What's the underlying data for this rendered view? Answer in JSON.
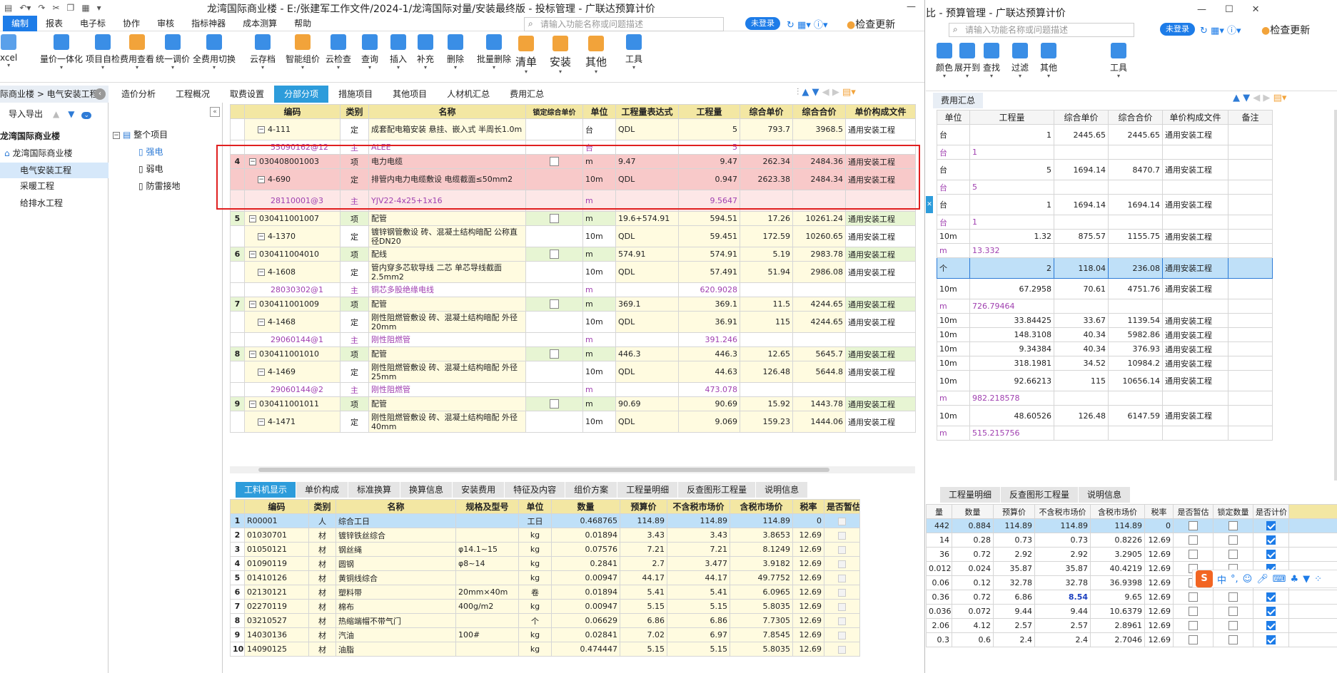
{
  "left": {
    "title": "龙湾国际商业楼 - E:/张建军工作文件/2024-1/龙湾国际对量/安装最终版 - 投标管理 - 广联达预算计价",
    "menu": [
      "编制",
      "报表",
      "电子标",
      "协作",
      "审核",
      "指标神器",
      "成本测算",
      "帮助"
    ],
    "search_placeholder": "请输入功能名称或问题描述",
    "login": "未登录",
    "check_update": "检查更新",
    "ribbon": [
      "xcel",
      "量价一体化",
      "项目自检",
      "费用查看",
      "统一调价",
      "全费用切换",
      "云存档",
      "智能组价",
      "云检查",
      "查询",
      "插入",
      "补充",
      "删除",
      "批量删除",
      "清单",
      "安装",
      "其他",
      "工具"
    ],
    "breadcrumb": "际商业楼 > 电气安装工程",
    "tabs": [
      "造价分析",
      "工程概况",
      "取费设置",
      "分部分项",
      "措施项目",
      "其他项目",
      "人材机汇总",
      "费用汇总"
    ],
    "import_export": "导入导出",
    "project_tree": [
      "龙湾国际商业楼",
      "龙湾国际商业楼",
      "电气安装工程",
      "采暖工程",
      "给排水工程"
    ],
    "sub_tree": [
      "整个项目",
      "强电",
      "弱电",
      "防雷接地"
    ],
    "main_headers": [
      "编码",
      "类别",
      "名称",
      "锁定综合单价",
      "单位",
      "工程量表达式",
      "工程量",
      "综合单价",
      "综合合价",
      "单价构成文件"
    ],
    "main_rows": [
      {
        "no": "",
        "code": "4-111",
        "type": "定",
        "name": "成套配电箱安装 悬挂、嵌入式 半周长1.0m",
        "lock": "",
        "unit": "台",
        "expr": "QDL",
        "qty": "5",
        "price": "793.7",
        "total": "3968.5",
        "file": "通用安装工程",
        "cls": "rd"
      },
      {
        "no": "",
        "code": "55090162@12",
        "type": "主",
        "name": "ALEE",
        "lock": "",
        "unit": "台",
        "expr": "",
        "qty": "5",
        "price": "",
        "total": "",
        "file": "",
        "cls": "rm"
      },
      {
        "no": "4",
        "code": "030408001003",
        "type": "项",
        "name": "电力电缆",
        "lock": "cb",
        "unit": "m",
        "expr": "9.47",
        "qty": "9.47",
        "price": "262.34",
        "total": "2484.36",
        "file": "通用安装工程",
        "cls": "rp"
      },
      {
        "no": "",
        "code": "4-690",
        "type": "定",
        "name": "排管内电力电缆敷设 电缆截面≤50mm2",
        "lock": "",
        "unit": "10m",
        "expr": "QDL",
        "qty": "0.947",
        "price": "2623.38",
        "total": "2484.34",
        "file": "通用安装工程",
        "cls": "rp"
      },
      {
        "no": "",
        "code": "28110001@3",
        "type": "主",
        "name": "YJV22-4x25+1x16",
        "lock": "",
        "unit": "m",
        "expr": "",
        "qty": "9.5647",
        "price": "",
        "total": "",
        "file": "",
        "cls": "rpm"
      },
      {
        "no": "5",
        "code": "030411001007",
        "type": "项",
        "name": "配管",
        "lock": "cb",
        "unit": "m",
        "expr": "19.6+574.91",
        "qty": "594.51",
        "price": "17.26",
        "total": "10261.24",
        "file": "通用安装工程",
        "cls": "rq"
      },
      {
        "no": "",
        "code": "4-1370",
        "type": "定",
        "name": "镀锌钢管敷设 砖、混凝土结构暗配 公称直径DN20",
        "lock": "",
        "unit": "10m",
        "expr": "QDL",
        "qty": "59.451",
        "price": "172.59",
        "total": "10260.65",
        "file": "通用安装工程",
        "cls": "rd"
      },
      {
        "no": "6",
        "code": "030411004010",
        "type": "项",
        "name": "配线",
        "lock": "cb",
        "unit": "m",
        "expr": "574.91",
        "qty": "574.91",
        "price": "5.19",
        "total": "2983.78",
        "file": "通用安装工程",
        "cls": "rq"
      },
      {
        "no": "",
        "code": "4-1608",
        "type": "定",
        "name": "管内穿多芯软导线 二芯 单芯导线截面2.5mm2",
        "lock": "",
        "unit": "10m",
        "expr": "QDL",
        "qty": "57.491",
        "price": "51.94",
        "total": "2986.08",
        "file": "通用安装工程",
        "cls": "rd"
      },
      {
        "no": "",
        "code": "28030302@1",
        "type": "主",
        "name": "铜芯多股绝缘电线",
        "lock": "",
        "unit": "m",
        "expr": "",
        "qty": "620.9028",
        "price": "",
        "total": "",
        "file": "",
        "cls": "rm"
      },
      {
        "no": "7",
        "code": "030411001009",
        "type": "项",
        "name": "配管",
        "lock": "cb",
        "unit": "m",
        "expr": "369.1",
        "qty": "369.1",
        "price": "11.5",
        "total": "4244.65",
        "file": "通用安装工程",
        "cls": "rq"
      },
      {
        "no": "",
        "code": "4-1468",
        "type": "定",
        "name": "刚性阻燃管敷设 砖、混凝土结构暗配 外径20mm",
        "lock": "",
        "unit": "10m",
        "expr": "QDL",
        "qty": "36.91",
        "price": "115",
        "total": "4244.65",
        "file": "通用安装工程",
        "cls": "rd"
      },
      {
        "no": "",
        "code": "29060144@1",
        "type": "主",
        "name": "刚性阻燃管",
        "lock": "",
        "unit": "m",
        "expr": "",
        "qty": "391.246",
        "price": "",
        "total": "",
        "file": "",
        "cls": "rm"
      },
      {
        "no": "8",
        "code": "030411001010",
        "type": "项",
        "name": "配管",
        "lock": "cb",
        "unit": "m",
        "expr": "446.3",
        "qty": "446.3",
        "price": "12.65",
        "total": "5645.7",
        "file": "通用安装工程",
        "cls": "rq"
      },
      {
        "no": "",
        "code": "4-1469",
        "type": "定",
        "name": "刚性阻燃管敷设 砖、混凝土结构暗配 外径25mm",
        "lock": "",
        "unit": "10m",
        "expr": "QDL",
        "qty": "44.63",
        "price": "126.48",
        "total": "5644.8",
        "file": "通用安装工程",
        "cls": "rd"
      },
      {
        "no": "",
        "code": "29060144@2",
        "type": "主",
        "name": "刚性阻燃管",
        "lock": "",
        "unit": "m",
        "expr": "",
        "qty": "473.078",
        "price": "",
        "total": "",
        "file": "",
        "cls": "rm"
      },
      {
        "no": "9",
        "code": "030411001011",
        "type": "项",
        "name": "配管",
        "lock": "cb",
        "unit": "m",
        "expr": "90.69",
        "qty": "90.69",
        "price": "15.92",
        "total": "1443.78",
        "file": "通用安装工程",
        "cls": "rq"
      },
      {
        "no": "",
        "code": "4-1471",
        "type": "定",
        "name": "刚性阻燃管敷设 砖、混凝土结构暗配 外径40mm",
        "lock": "",
        "unit": "10m",
        "expr": "QDL",
        "qty": "9.069",
        "price": "159.23",
        "total": "1444.06",
        "file": "通用安装工程",
        "cls": "rd"
      }
    ],
    "bottom_tabs": [
      "工料机显示",
      "单价构成",
      "标准换算",
      "换算信息",
      "安装费用",
      "特征及内容",
      "组价方案",
      "工程量明细",
      "反查图形工程量",
      "说明信息"
    ],
    "bottom_headers": [
      "编码",
      "类别",
      "名称",
      "规格及型号",
      "单位",
      "数量",
      "预算价",
      "不含税市场价",
      "含税市场价",
      "税率",
      "是否暂估"
    ],
    "bottom_rows": [
      {
        "no": "1",
        "code": "R00001",
        "type": "人",
        "name": "综合工日",
        "spec": "",
        "unit": "工日",
        "qty": "0.468765",
        "budget": "114.89",
        "mkt": "114.89",
        "mkt_tax": "114.89",
        "rate": "0"
      },
      {
        "no": "2",
        "code": "01030701",
        "type": "材",
        "name": "镀锌铁丝综合",
        "spec": "",
        "unit": "kg",
        "qty": "0.01894",
        "budget": "3.43",
        "mkt": "3.43",
        "mkt_tax": "3.8653",
        "rate": "12.69"
      },
      {
        "no": "3",
        "code": "01050121",
        "type": "材",
        "name": "钢丝绳",
        "spec": "φ14.1~15",
        "unit": "kg",
        "qty": "0.07576",
        "budget": "7.21",
        "mkt": "7.21",
        "mkt_tax": "8.1249",
        "rate": "12.69"
      },
      {
        "no": "4",
        "code": "01090119",
        "type": "材",
        "name": "圆钢",
        "spec": "φ8~14",
        "unit": "kg",
        "qty": "0.2841",
        "budget": "2.7",
        "mkt": "3.477",
        "mkt_tax": "3.9182",
        "rate": "12.69"
      },
      {
        "no": "5",
        "code": "01410126",
        "type": "材",
        "name": "黄铜线综合",
        "spec": "",
        "unit": "kg",
        "qty": "0.00947",
        "budget": "44.17",
        "mkt": "44.17",
        "mkt_tax": "49.7752",
        "rate": "12.69"
      },
      {
        "no": "6",
        "code": "02130121",
        "type": "材",
        "name": "塑料带",
        "spec": "20mm×40m",
        "unit": "卷",
        "qty": "0.01894",
        "budget": "5.41",
        "mkt": "5.41",
        "mkt_tax": "6.0965",
        "rate": "12.69"
      },
      {
        "no": "7",
        "code": "02270119",
        "type": "材",
        "name": "棉布",
        "spec": "400g/m2",
        "unit": "kg",
        "qty": "0.00947",
        "budget": "5.15",
        "mkt": "5.15",
        "mkt_tax": "5.8035",
        "rate": "12.69"
      },
      {
        "no": "8",
        "code": "03210527",
        "type": "材",
        "name": "热缩端帽不带气门",
        "spec": "",
        "unit": "个",
        "qty": "0.06629",
        "budget": "6.86",
        "mkt": "6.86",
        "mkt_tax": "7.7305",
        "rate": "12.69"
      },
      {
        "no": "9",
        "code": "14030136",
        "type": "材",
        "name": "汽油",
        "spec": "100#",
        "unit": "kg",
        "qty": "0.02841",
        "budget": "7.02",
        "mkt": "6.97",
        "mkt_tax": "7.8545",
        "rate": "12.69"
      },
      {
        "no": "10",
        "code": "14090125",
        "type": "材",
        "name": "油脂",
        "spec": "",
        "unit": "kg",
        "qty": "0.474447",
        "budget": "5.15",
        "mkt": "5.15",
        "mkt_tax": "5.8035",
        "rate": "12.69"
      }
    ]
  },
  "right": {
    "title": "比 - 预算管理 - 广联达预算计价",
    "search_placeholder": "请输入功能名称或问题描述",
    "login": "未登录",
    "check_update": "检查更新",
    "ribbon": [
      "颜色",
      "展开到",
      "查找",
      "过滤",
      "其他",
      "工具"
    ],
    "tab": "费用汇总",
    "headers": [
      "单位",
      "工程量",
      "综合单价",
      "综合合价",
      "单价构成文件",
      "备注"
    ],
    "rows": [
      {
        "unit": "台",
        "qty": "1",
        "price": "2445.65",
        "total": "2445.65",
        "file": "通用安装工程",
        "m": false,
        "tall": true
      },
      {
        "unit": "台",
        "qty": "1",
        "price": "",
        "total": "",
        "file": "",
        "m": true,
        "tall": false
      },
      {
        "unit": "台",
        "qty": "5",
        "price": "1694.14",
        "total": "8470.7",
        "file": "通用安装工程",
        "m": false,
        "tall": true
      },
      {
        "unit": "台",
        "qty": "5",
        "price": "",
        "total": "",
        "file": "",
        "m": true,
        "tall": false
      },
      {
        "unit": "台",
        "qty": "1",
        "price": "1694.14",
        "total": "1694.14",
        "file": "通用安装工程",
        "m": false,
        "tall": true
      },
      {
        "unit": "台",
        "qty": "1",
        "price": "",
        "total": "",
        "file": "",
        "m": true,
        "tall": false
      },
      {
        "unit": "10m",
        "qty": "1.32",
        "price": "875.57",
        "total": "1155.75",
        "file": "通用安装工程",
        "m": false,
        "tall": false
      },
      {
        "unit": "m",
        "qty": "13.332",
        "price": "",
        "total": "",
        "file": "",
        "m": true,
        "tall": false
      },
      {
        "unit": "个",
        "qty": "2",
        "price": "118.04",
        "total": "236.08",
        "file": "通用安装工程",
        "m": false,
        "tall": true,
        "sel": true
      },
      {
        "unit": "10m",
        "qty": "67.2958",
        "price": "70.61",
        "total": "4751.76",
        "file": "通用安装工程",
        "m": false,
        "tall": true
      },
      {
        "unit": "m",
        "qty": "726.79464",
        "price": "",
        "total": "",
        "file": "",
        "m": true,
        "tall": false
      },
      {
        "unit": "10m",
        "qty": "33.84425",
        "price": "33.67",
        "total": "1139.54",
        "file": "通用安装工程",
        "m": false,
        "tall": false
      },
      {
        "unit": "10m",
        "qty": "148.3108",
        "price": "40.34",
        "total": "5982.86",
        "file": "通用安装工程",
        "m": false,
        "tall": false
      },
      {
        "unit": "10m",
        "qty": "9.34384",
        "price": "40.34",
        "total": "376.93",
        "file": "通用安装工程",
        "m": false,
        "tall": false
      },
      {
        "unit": "10m",
        "qty": "318.1981",
        "price": "34.52",
        "total": "10984.2",
        "file": "通用安装工程",
        "m": false,
        "tall": false
      },
      {
        "unit": "10m",
        "qty": "92.66213",
        "price": "115",
        "total": "10656.14",
        "file": "通用安装工程",
        "m": false,
        "tall": true
      },
      {
        "unit": "m",
        "qty": "982.218578",
        "price": "",
        "total": "",
        "file": "",
        "m": true,
        "tall": false
      },
      {
        "unit": "10m",
        "qty": "48.60526",
        "price": "126.48",
        "total": "6147.59",
        "file": "通用安装工程",
        "m": false,
        "tall": true
      },
      {
        "unit": "m",
        "qty": "515.215756",
        "price": "",
        "total": "",
        "file": "",
        "m": true,
        "tall": false
      }
    ],
    "bottom_tabs": [
      "工程量明细",
      "反查图形工程量",
      "说明信息"
    ],
    "bottom_headers": [
      "量",
      "数量",
      "预算价",
      "不含税市场价",
      "含税市场价",
      "税率",
      "是否暂估",
      "锁定数量",
      "是否计价"
    ],
    "bottom_rows": [
      {
        "a": "442",
        "qty": "0.884",
        "budget": "114.89",
        "mkt": "114.89",
        "mkt_tax": "114.89",
        "rate": "0",
        "bold": false
      },
      {
        "a": "14",
        "qty": "0.28",
        "budget": "0.73",
        "mkt": "0.73",
        "mkt_tax": "0.8226",
        "rate": "12.69",
        "bold": false
      },
      {
        "a": "36",
        "qty": "0.72",
        "budget": "2.92",
        "mkt": "2.92",
        "mkt_tax": "3.2905",
        "rate": "12.69",
        "bold": false
      },
      {
        "a": "0.012",
        "qty": "0.024",
        "budget": "35.87",
        "mkt": "35.87",
        "mkt_tax": "40.4219",
        "rate": "12.69",
        "bold": false
      },
      {
        "a": "0.06",
        "qty": "0.12",
        "budget": "32.78",
        "mkt": "32.78",
        "mkt_tax": "36.9398",
        "rate": "12.69",
        "bold": false
      },
      {
        "a": "0.36",
        "qty": "0.72",
        "budget": "6.86",
        "mkt": "8.54",
        "mkt_tax": "9.65",
        "rate": "12.69",
        "bold": true
      },
      {
        "a": "0.036",
        "qty": "0.072",
        "budget": "9.44",
        "mkt": "9.44",
        "mkt_tax": "10.6379",
        "rate": "12.69",
        "bold": false
      },
      {
        "a": "2.06",
        "qty": "4.12",
        "budget": "2.57",
        "mkt": "2.57",
        "mkt_tax": "2.8961",
        "rate": "12.69",
        "bold": false
      },
      {
        "a": "0.3",
        "qty": "0.6",
        "budget": "2.4",
        "mkt": "2.4",
        "mkt_tax": "2.7046",
        "rate": "12.69",
        "bold": false
      }
    ]
  },
  "ime": {
    "lang": "中",
    "s": "S"
  }
}
